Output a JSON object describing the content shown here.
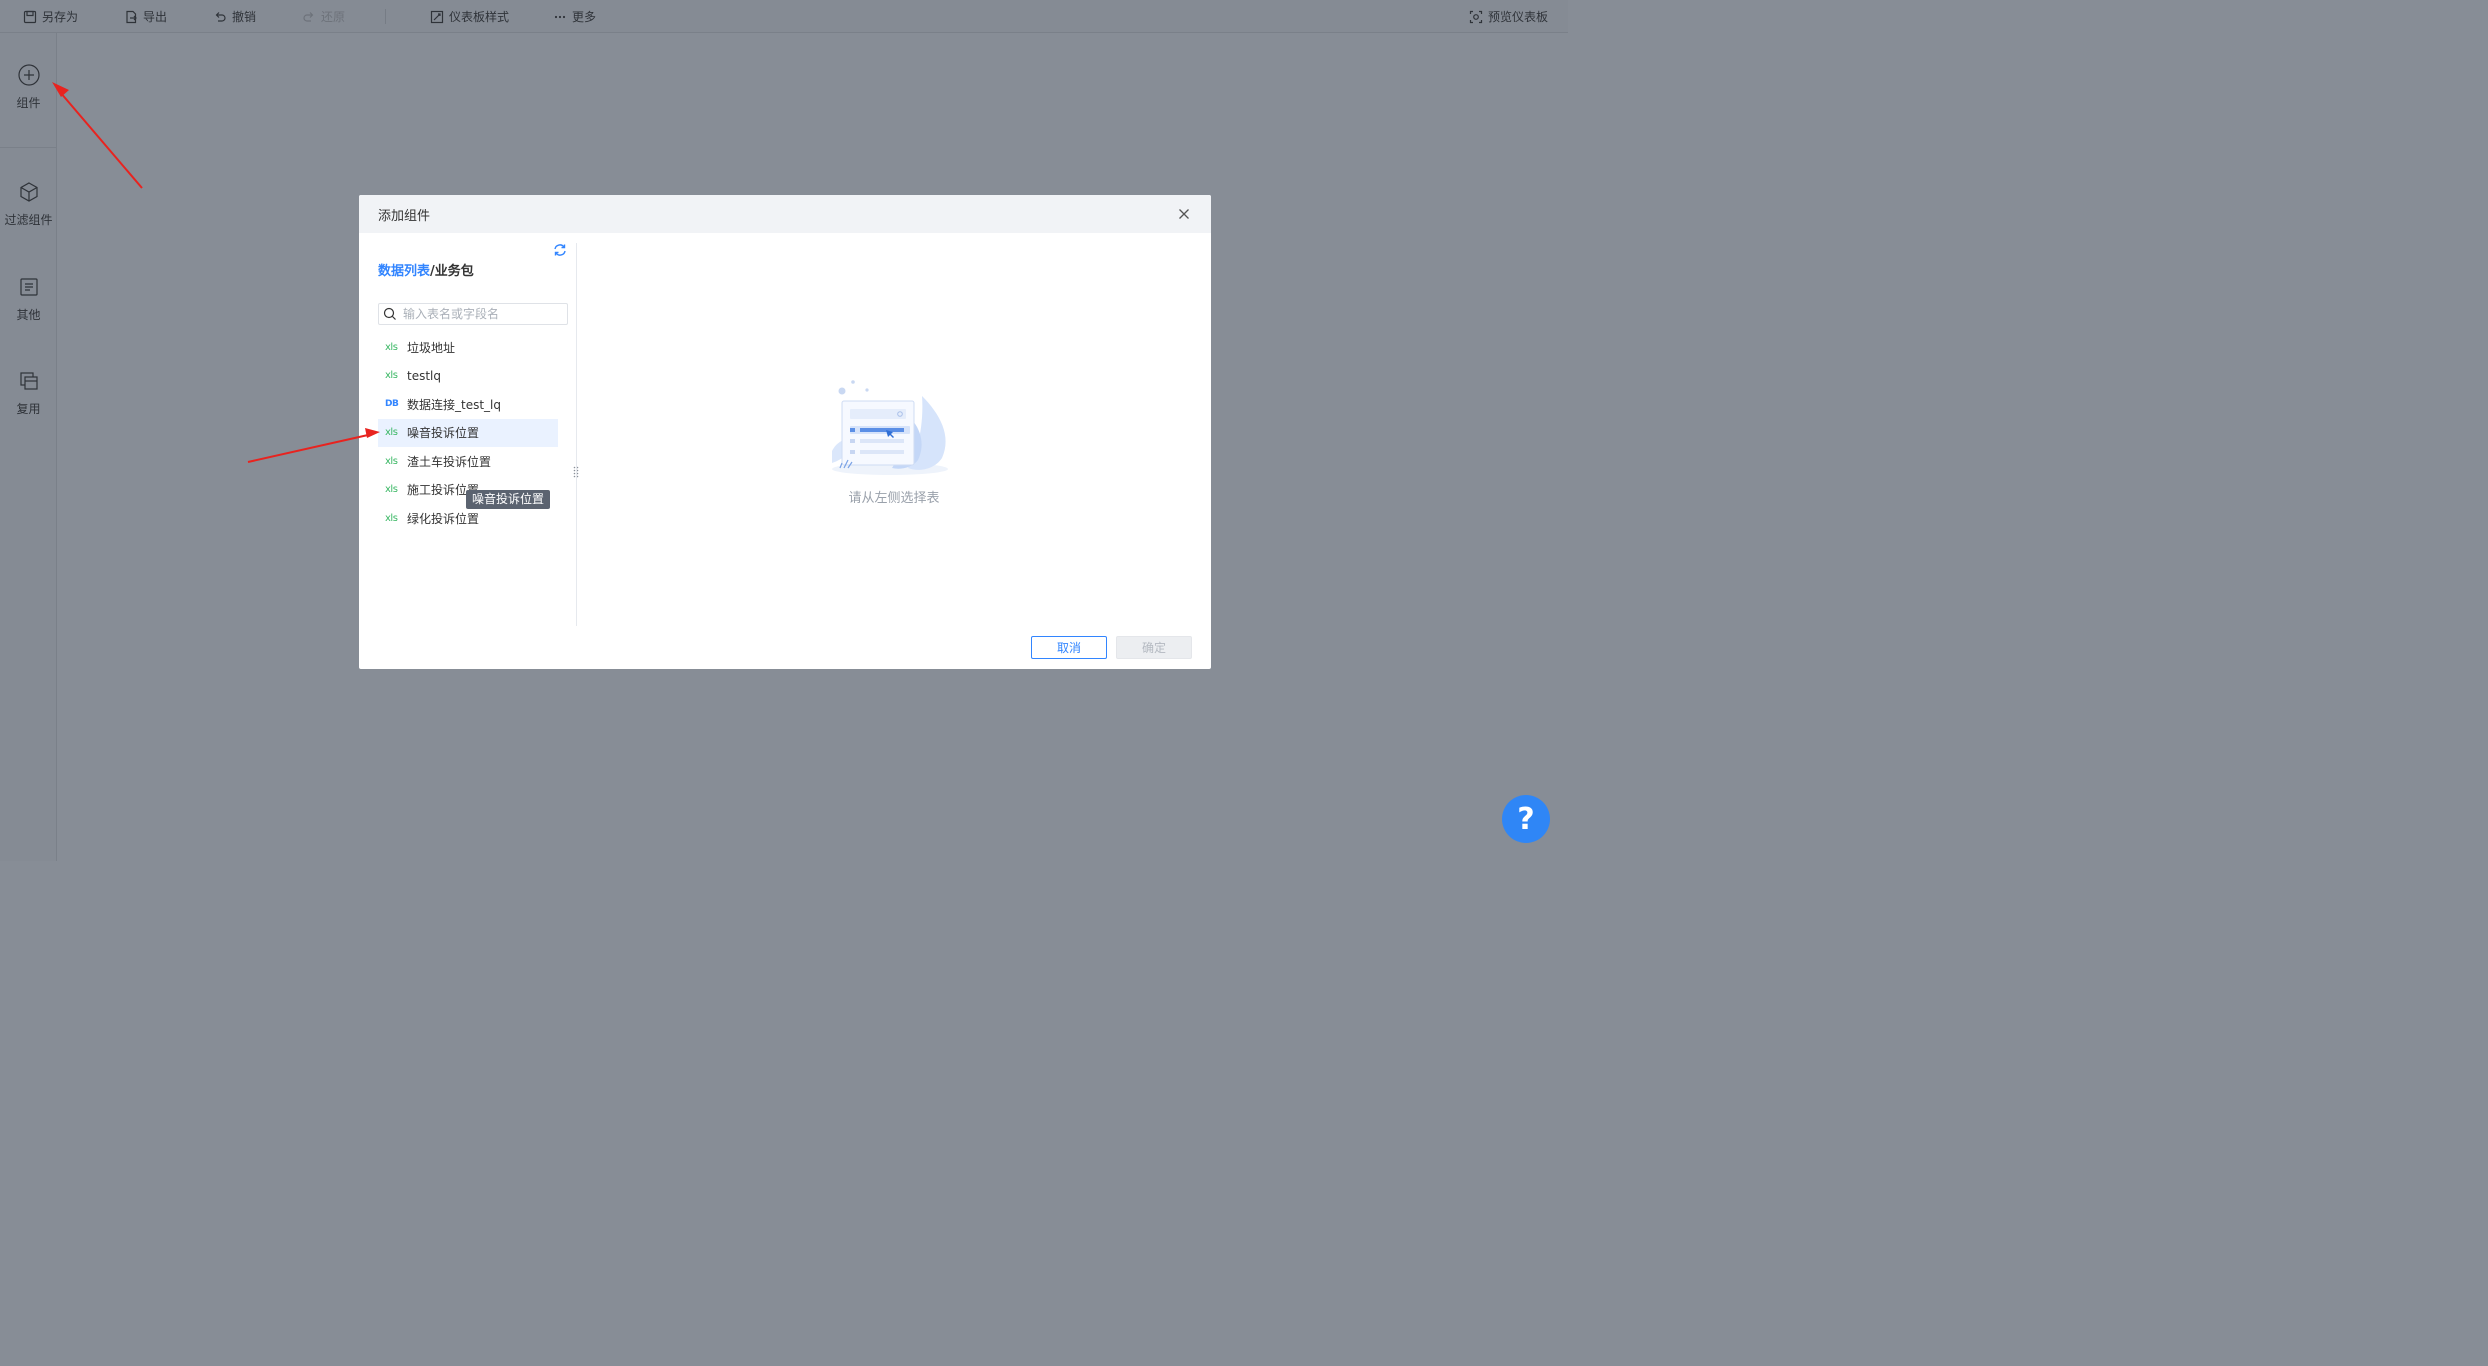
{
  "toolbar": {
    "save_as": "另存为",
    "export": "导出",
    "undo": "撤销",
    "redo": "还原",
    "dashboard_style": "仪表板样式",
    "more": "更多",
    "preview": "预览仪表板"
  },
  "sidebar": {
    "items": [
      {
        "label": "组件",
        "icon": "plus-circle-icon"
      },
      {
        "label": "过滤组件",
        "icon": "cube-icon"
      },
      {
        "label": "其他",
        "icon": "document-icon"
      },
      {
        "label": "复用",
        "icon": "stack-icon"
      }
    ]
  },
  "dialog": {
    "title": "添加组件",
    "breadcrumb_link": "数据列表",
    "breadcrumb_sep": "/",
    "breadcrumb_current": "业务包",
    "search_placeholder": "输入表名或字段名",
    "tables": [
      {
        "type": "xls",
        "name": "垃圾地址"
      },
      {
        "type": "xls",
        "name": "testlq"
      },
      {
        "type": "db",
        "name": "数据连接_test_lq"
      },
      {
        "type": "xls",
        "name": "噪音投诉位置",
        "selected": true
      },
      {
        "type": "xls",
        "name": "渣土车投诉位置"
      },
      {
        "type": "xls",
        "name": "施工投诉位置"
      },
      {
        "type": "xls",
        "name": "绿化投诉位置"
      }
    ],
    "icon_xls": "xls",
    "icon_db": "DB",
    "tooltip": "噪音投诉位置",
    "empty_text": "请从左侧选择表",
    "cancel": "取消",
    "confirm": "确定"
  },
  "help": "?",
  "colors": {
    "accent": "#3285ff",
    "annotation": "#e8231f",
    "xls_icon": "#3ab764"
  }
}
